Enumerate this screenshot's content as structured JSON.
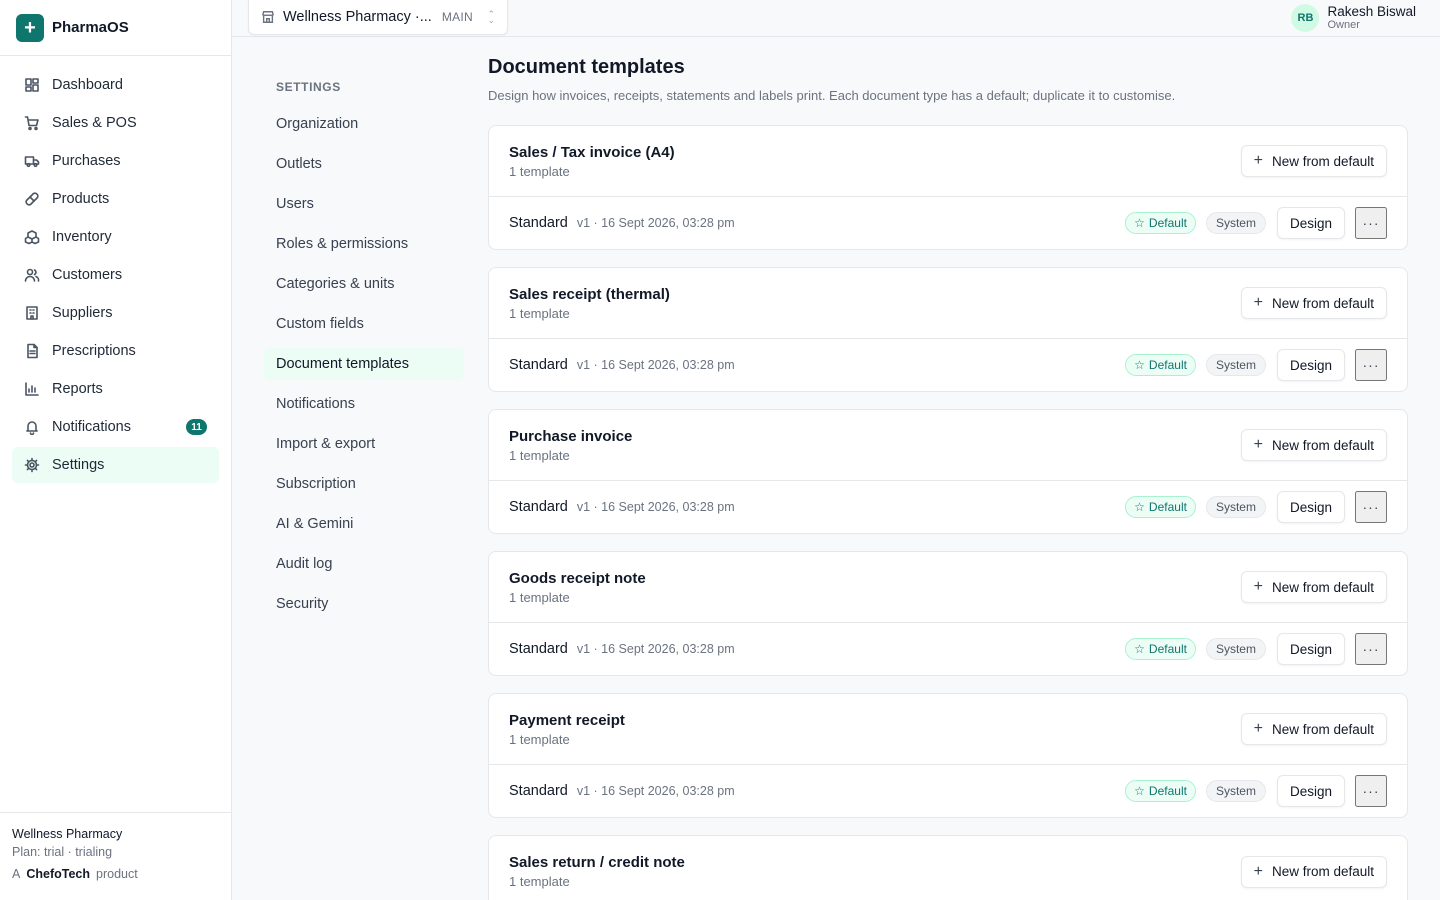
{
  "brand": {
    "name": "PharmaOS",
    "logo_glyph": "+"
  },
  "sidebar": {
    "items": [
      {
        "label": "Dashboard",
        "icon": "dashboard-icon"
      },
      {
        "label": "Sales & POS",
        "icon": "cart-icon"
      },
      {
        "label": "Purchases",
        "icon": "truck-icon"
      },
      {
        "label": "Products",
        "icon": "pill-icon"
      },
      {
        "label": "Inventory",
        "icon": "boxes-icon"
      },
      {
        "label": "Customers",
        "icon": "users-icon"
      },
      {
        "label": "Suppliers",
        "icon": "building-icon"
      },
      {
        "label": "Prescriptions",
        "icon": "file-icon"
      },
      {
        "label": "Reports",
        "icon": "bar-chart-icon"
      },
      {
        "label": "Notifications",
        "icon": "bell-icon",
        "badge": "11"
      },
      {
        "label": "Settings",
        "icon": "gear-icon",
        "active": true
      }
    ],
    "footer": {
      "org_name": "Wellness Pharmacy",
      "plan": "Plan: trial · trialing",
      "made_by_prefix": "A",
      "company": "ChefoTech",
      "made_by_suffix": "product"
    }
  },
  "topbar": {
    "outlet_name": "Wellness Pharmacy ·...",
    "outlet_tag": "MAIN",
    "user": {
      "initials": "RB",
      "name": "Rakesh Biswal",
      "role": "Owner"
    }
  },
  "settings_nav": {
    "heading": "SETTINGS",
    "items": [
      "Organization",
      "Outlets",
      "Users",
      "Roles & permissions",
      "Categories & units",
      "Custom fields",
      "Document templates",
      "Notifications",
      "Import & export",
      "Subscription",
      "AI & Gemini",
      "Audit log",
      "Security"
    ],
    "active_index": 6
  },
  "main": {
    "title": "Document templates",
    "description": "Design how invoices, receipts, statements and labels print. Each document type has a default; duplicate it to customise.",
    "new_button_label": "New from default",
    "design_button_label": "Design",
    "default_badge": "Default",
    "system_badge": "System",
    "more_glyph": "···",
    "cards": [
      {
        "title": "Sales / Tax invoice (A4)",
        "count": "1 template",
        "template": {
          "name": "Standard",
          "meta": "v1 · 16 Sept 2026, 03:28 pm"
        }
      },
      {
        "title": "Sales receipt (thermal)",
        "count": "1 template",
        "template": {
          "name": "Standard",
          "meta": "v1 · 16 Sept 2026, 03:28 pm"
        }
      },
      {
        "title": "Purchase invoice",
        "count": "1 template",
        "template": {
          "name": "Standard",
          "meta": "v1 · 16 Sept 2026, 03:28 pm"
        }
      },
      {
        "title": "Goods receipt note",
        "count": "1 template",
        "template": {
          "name": "Standard",
          "meta": "v1 · 16 Sept 2026, 03:28 pm"
        }
      },
      {
        "title": "Payment receipt",
        "count": "1 template",
        "template": {
          "name": "Standard",
          "meta": "v1 · 16 Sept 2026, 03:28 pm"
        }
      },
      {
        "title": "Sales return / credit note",
        "count": "1 template",
        "template": null
      }
    ]
  },
  "colors": {
    "accent": "#0f766e",
    "accent_soft": "#ecfdf5",
    "border": "#e5e7eb",
    "muted": "#6b7280"
  }
}
